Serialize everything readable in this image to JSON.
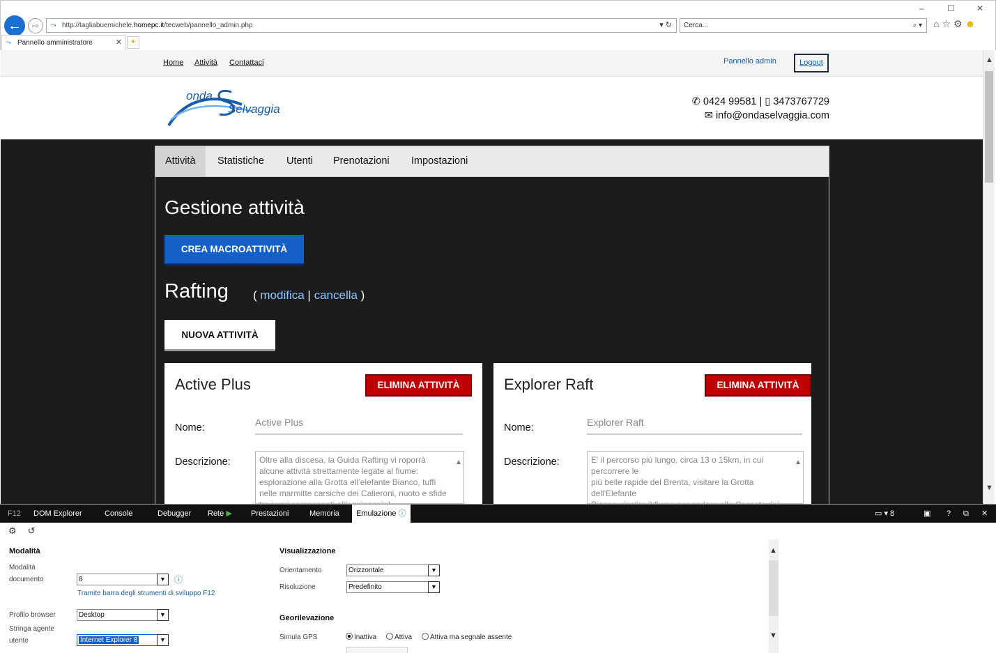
{
  "browser": {
    "url_prefix": "http://tagliabuemichele.",
    "url_host": "homepc.it",
    "url_path": "/tecweb/pannello_admin.php",
    "url_controls": "▾ ↻",
    "search_placeholder": "Cerca...",
    "search_controls": "⌕ ▾",
    "tab_title": "Pannello amministratore",
    "window_controls": {
      "minimize": "–",
      "maximize": "☐",
      "close": "✕"
    }
  },
  "topnav": {
    "home": "Home",
    "attivita": "Attività",
    "contattaci": "Contattaci",
    "admin": "Pannello admin",
    "logout": "Logout"
  },
  "brand": {
    "line1": "onda",
    "line2": "Selvaggia",
    "color": "#1a5ea8"
  },
  "contact": {
    "phone": "0424 99581",
    "mobile": "3473767729",
    "email": "info@ondaselvaggia.com",
    "separator": "|"
  },
  "admin_tabs": [
    "Attività",
    "Statistiche",
    "Utenti",
    "Prenotazioni",
    "Impostazioni"
  ],
  "page": {
    "title": "Gestione attività",
    "create_macro": "CREA MACROATTIVITÀ",
    "macro_name": "Rafting",
    "edit": "modifica",
    "delete": "cancella",
    "new_activity": "NUOVA ATTIVITÀ"
  },
  "activities": [
    {
      "title": "Active Plus",
      "delete_label": "ELIMINA ATTIVITÀ",
      "name_label": "Nome:",
      "name_value": "Active Plus",
      "desc_label": "Descrizione:",
      "desc_value": "Oltre alla discesa, la Guida Rafting vi roporrà alcune attività strettamente legate al fiume: esplorazione alla Grotta ell’elefante Bianco, tuffi nelle marmitte carsiche dei Calieroni, nuoto e sfide tra i vari componenti all’equipaggio!"
    },
    {
      "title": "Explorer Raft",
      "delete_label": "ELIMINA ATTIVITÀ",
      "name_label": "Nome:",
      "name_value": "Explorer Raft",
      "desc_label": "Descrizione:",
      "desc_value": "E' il percorso più lungo, circa 13 o 15km, in cui percorrere le\npiù belle rapide del Brenta, visitare la Grotta dell'Elefante\nBianco, risalire il fiume per andare alle Cascate dei"
    }
  ],
  "devtools": {
    "tabs": [
      "F12",
      "DOM Explorer",
      "Console",
      "Debugger",
      "Rete",
      "Prestazioni",
      "Memoria",
      "Emulazione"
    ],
    "device_label": "8",
    "right_icons": [
      "▣",
      "?",
      "⧉",
      "✕"
    ],
    "mode_section": "Modalità",
    "doc_mode_label": "Modalità documento",
    "doc_mode_value": "8",
    "doc_mode_hint": "Tramite barra degli strumenti di sviluppo F12",
    "browser_profile_label": "Profilo browser",
    "browser_profile_value": "Desktop",
    "ua_label": "Stringa agente utente",
    "ua_value": "Internet Explorer 8",
    "display_section": "Visualizzazione",
    "orientation_label": "Orientamento",
    "orientation_value": "Orizzontale",
    "resolution_label": "Risoluzione",
    "resolution_value": "Predefinito",
    "geo_section": "Georilevazione",
    "gps_label": "Simula GPS",
    "gps_options": [
      "Inattiva",
      "Attiva",
      "Attiva ma segnale assente"
    ],
    "gps_selected": "Inattiva"
  }
}
